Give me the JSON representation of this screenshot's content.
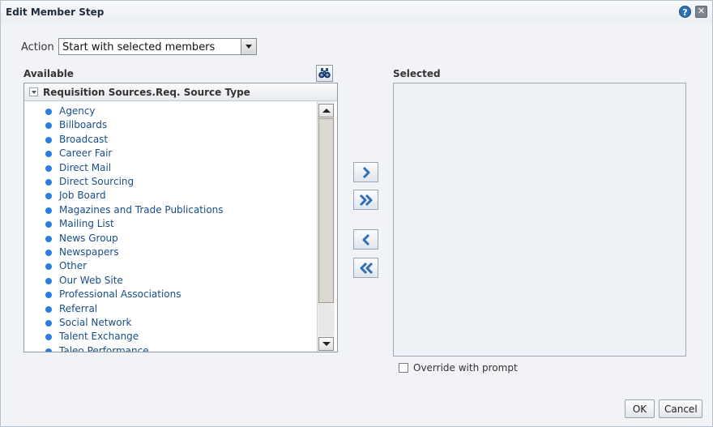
{
  "dialog": {
    "title": "Edit Member Step",
    "help_icon_glyph": "?",
    "close_icon_glyph": "✕"
  },
  "action": {
    "label": "Action",
    "selected_value": "Start with selected members"
  },
  "available": {
    "label": "Available",
    "header": "Requisition Sources.Req. Source Type",
    "members": [
      "Agency",
      "Billboards",
      "Broadcast",
      "Career Fair",
      "Direct Mail",
      "Direct Sourcing",
      "Job Board",
      "Magazines and Trade Publications",
      "Mailing List",
      "News Group",
      "Newspapers",
      "Other",
      "Our Web Site",
      "Professional Associations",
      "Referral",
      "Social Network",
      "Talent Exchange",
      "Taleo Performance"
    ]
  },
  "selected": {
    "label": "Selected"
  },
  "override": {
    "label": "Override with prompt",
    "checked": false
  },
  "footer": {
    "ok_label": "OK",
    "cancel_label": "Cancel"
  },
  "colors": {
    "member_dot": "#2a7de1",
    "member_text": "#1a4d87",
    "shuttle_arrow": "#2f6fb3"
  }
}
